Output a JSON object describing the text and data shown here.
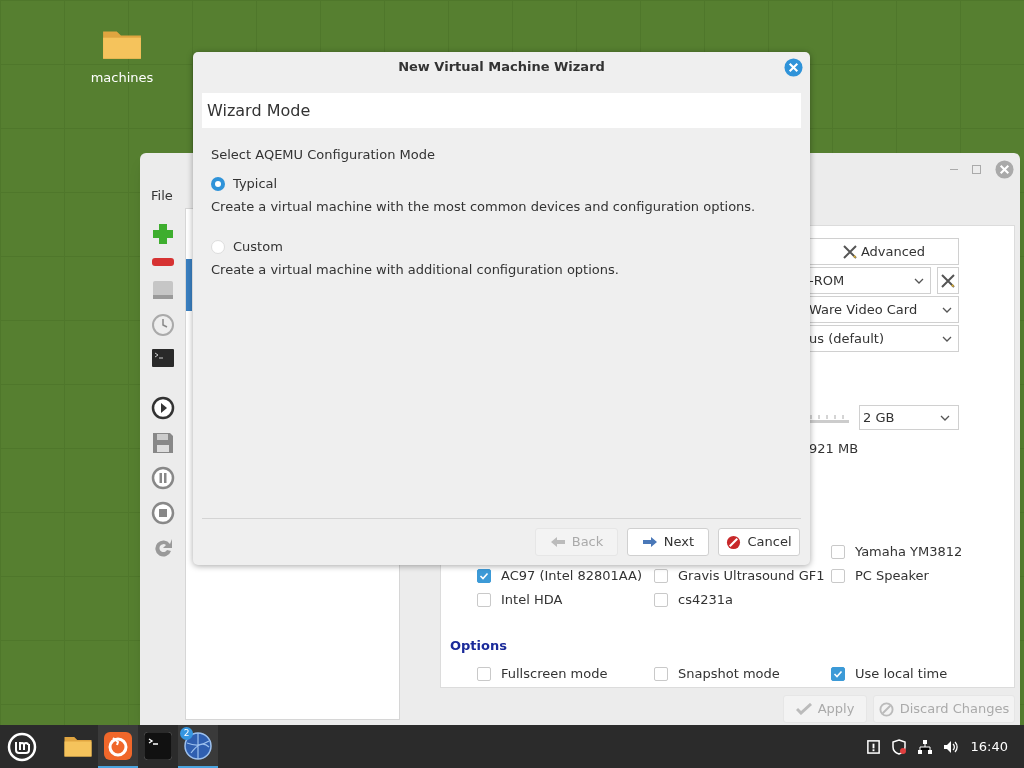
{
  "desktop": {
    "icons": [
      {
        "label": "machines"
      }
    ]
  },
  "main_window": {
    "menu": [
      "File"
    ],
    "advanced_button": "Advanced",
    "combos": [
      {
        "value": "-ROM",
        "tool": true
      },
      {
        "value": "Ware Video Card",
        "tool": false
      },
      {
        "value": "us (default)",
        "tool": false
      }
    ],
    "memory": {
      "value": "2 GB",
      "free": "921 MB"
    },
    "audio": [
      {
        "label": "Yamaha YM3812",
        "checked": false
      },
      {
        "label": "AC97 (Intel 82801AA)",
        "checked": true
      },
      {
        "label": "Gravis Ultrasound GF1",
        "checked": false
      },
      {
        "label": "PC Speaker",
        "checked": false
      },
      {
        "label": "Intel HDA",
        "checked": false
      },
      {
        "label": "cs4231a",
        "checked": false
      }
    ],
    "options_title": "Options",
    "options": [
      {
        "label": "Fullscreen mode",
        "checked": false
      },
      {
        "label": "Snapshot mode",
        "checked": false
      },
      {
        "label": "Use local time",
        "checked": true
      }
    ],
    "buttons": [
      {
        "label": "Apply",
        "disabled": true,
        "kind": "apply"
      },
      {
        "label": "Discard Changes",
        "disabled": true,
        "kind": "discard"
      }
    ]
  },
  "dialog": {
    "title": "New Virtual Machine Wizard",
    "header": "Wizard Mode",
    "prompt": "Select AQEMU Configuration Mode",
    "modes": [
      {
        "label": "Typical",
        "description": "Create a virtual machine with the most common devices and configuration options.",
        "selected": true
      },
      {
        "label": "Custom",
        "description": "Create a virtual machine with additional configuration options.",
        "selected": false
      }
    ],
    "buttons": [
      {
        "label": "Back",
        "disabled": true,
        "kind": "back"
      },
      {
        "label": "Next",
        "disabled": false,
        "kind": "next"
      },
      {
        "label": "Cancel",
        "disabled": false,
        "kind": "cancel"
      }
    ]
  },
  "taskbar": {
    "apps": [
      {
        "kind": "files",
        "active": false
      },
      {
        "kind": "browser",
        "active": true
      },
      {
        "kind": "terminal",
        "active": false
      },
      {
        "kind": "aqemu",
        "active": true,
        "badge": "2"
      }
    ],
    "clock": "16:40"
  }
}
